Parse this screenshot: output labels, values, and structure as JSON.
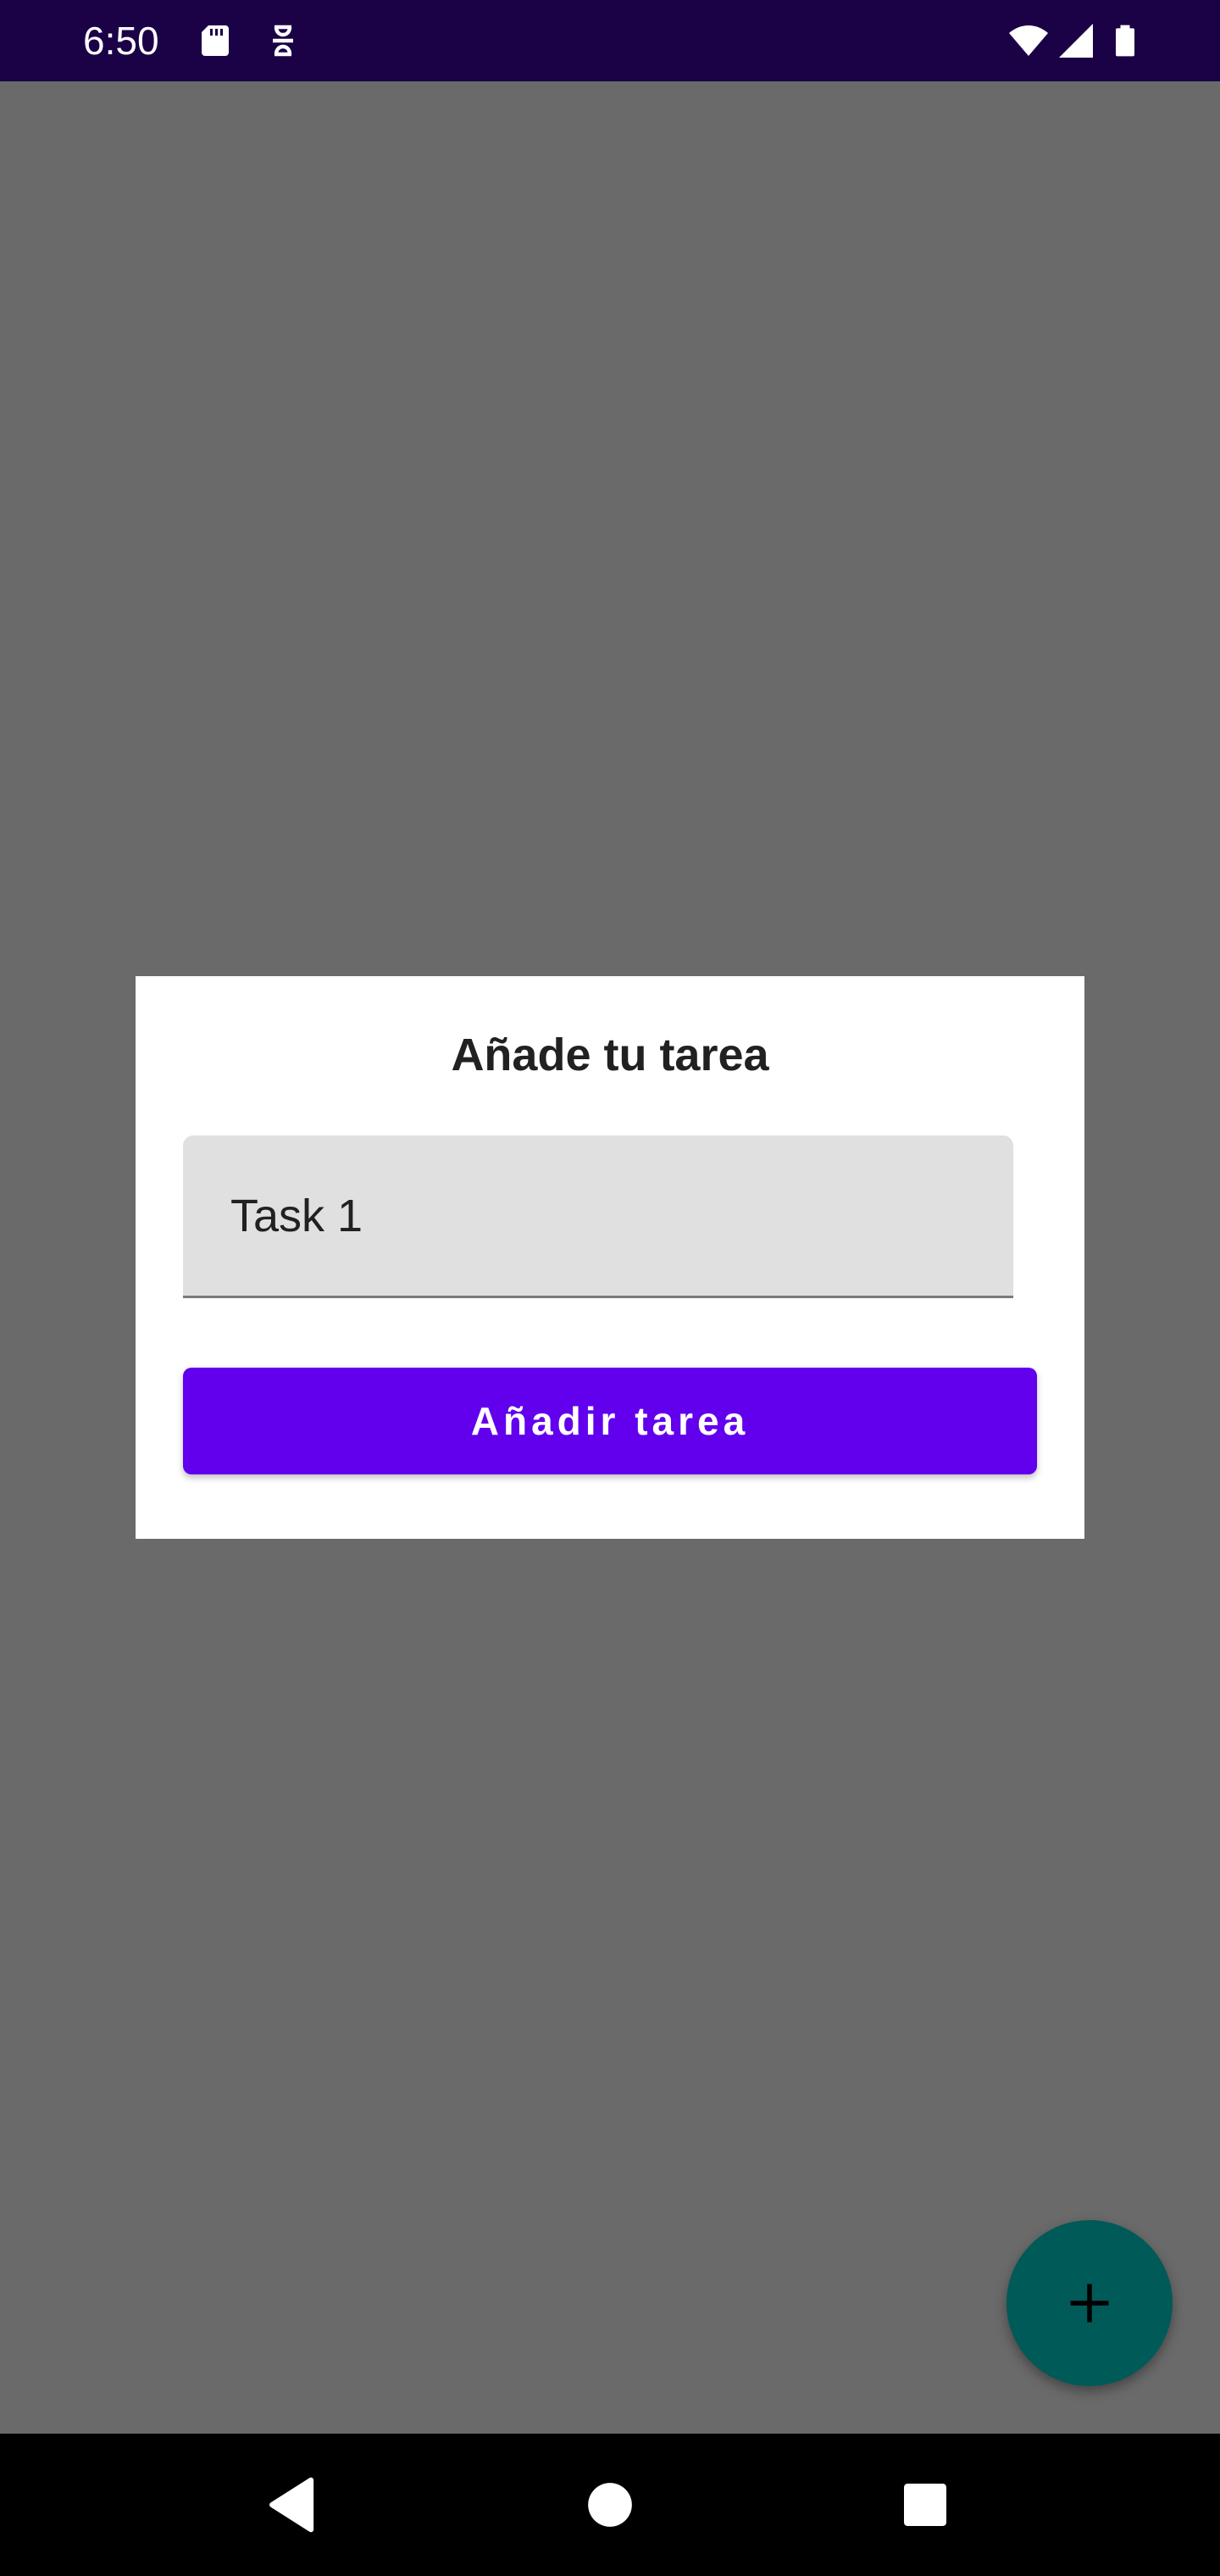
{
  "status_bar": {
    "time": "6:50",
    "icons": [
      "sd-card-icon",
      "notification-icon",
      "wifi-icon",
      "signal-icon",
      "battery-icon"
    ]
  },
  "dialog": {
    "title": "Añade tu tarea",
    "task_input_value": "Task 1",
    "add_button_label": "Añadir tarea"
  },
  "fab": {
    "icon": "plus-icon"
  },
  "nav_bar": {
    "icons": [
      "back-icon",
      "home-icon",
      "recents-icon"
    ]
  },
  "colors": {
    "status_bar": "#1b0146",
    "scrim_background": "#6a6a6a",
    "primary": "#6200ee",
    "fab": "#005a57",
    "field": "#e0e0e0"
  }
}
